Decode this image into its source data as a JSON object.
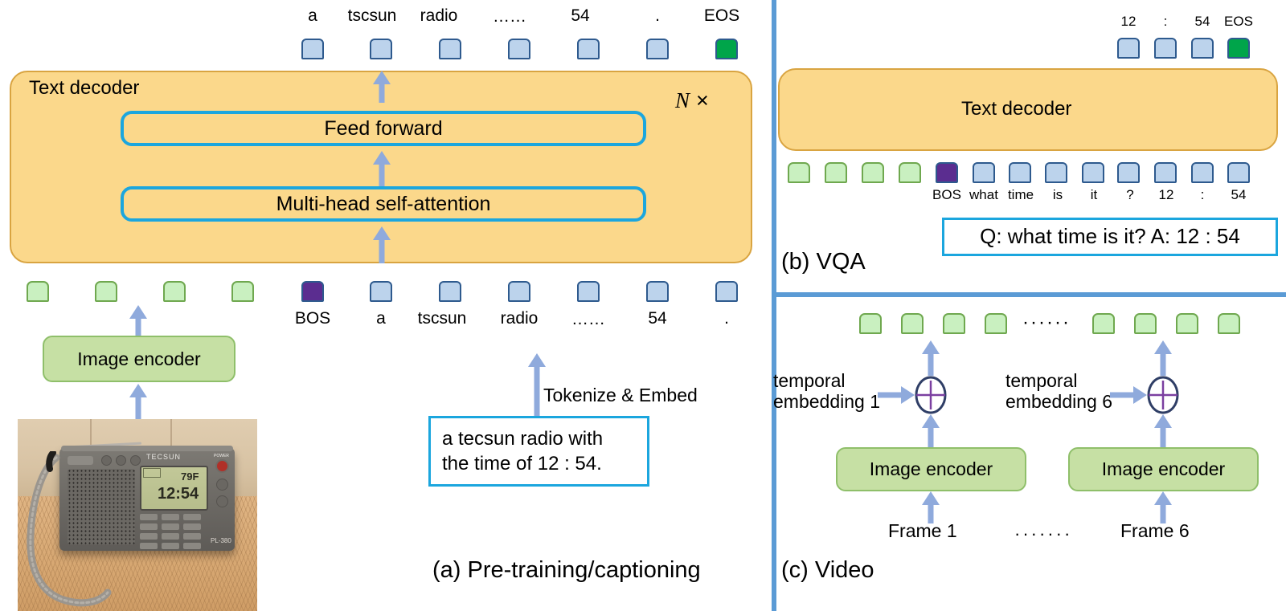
{
  "figure": {
    "panels": [
      {
        "id": "a",
        "caption": "(a) Pre-training/captioning"
      },
      {
        "id": "b",
        "caption": "(b) VQA"
      },
      {
        "id": "c",
        "caption": "(c) Video"
      }
    ]
  },
  "panel_a": {
    "output_tokens": [
      {
        "label": "a",
        "kind": "text"
      },
      {
        "label": "tscsun",
        "kind": "text"
      },
      {
        "label": "radio",
        "kind": "text"
      },
      {
        "label": "……",
        "kind": "text"
      },
      {
        "label": "54",
        "kind": "text"
      },
      {
        "label": ".",
        "kind": "text"
      },
      {
        "label": "EOS",
        "kind": "eos"
      }
    ],
    "decoder": {
      "title": "Text decoder",
      "repeat_label": "N ×",
      "repeat_symbol_n": "N",
      "repeat_symbol_x": "×",
      "sublayers": [
        {
          "label": "Feed forward"
        },
        {
          "label": "Multi-head self-attention"
        }
      ]
    },
    "image_tokens_count": 4,
    "input_tokens": [
      {
        "label": "BOS",
        "kind": "bos"
      },
      {
        "label": "a",
        "kind": "text"
      },
      {
        "label": "tscsun",
        "kind": "text"
      },
      {
        "label": "radio",
        "kind": "text"
      },
      {
        "label": "……",
        "kind": "text"
      },
      {
        "label": "54",
        "kind": "text"
      },
      {
        "label": ".",
        "kind": "text"
      }
    ],
    "image_encoder_label": "Image encoder",
    "tokenize_label": "Tokenize & Embed",
    "caption_box_line1": "a tecsun radio with",
    "caption_box_line2": "the time of 12 : 54.",
    "photo": {
      "alt": "photo of a Tecsun PL-380 portable radio on a woven mat",
      "brand_text": "TECSUN",
      "model_text": "PL-380",
      "lcd_temperature": "79F",
      "lcd_time": "12:54",
      "power_label": "POWER"
    }
  },
  "panel_b": {
    "output_tokens": [
      {
        "label": "12",
        "kind": "text"
      },
      {
        "label": ":",
        "kind": "text"
      },
      {
        "label": "54",
        "kind": "text"
      },
      {
        "label": "EOS",
        "kind": "eos"
      }
    ],
    "decoder_title": "Text decoder",
    "image_tokens_count": 4,
    "input_tokens": [
      {
        "label": "BOS",
        "kind": "bos"
      },
      {
        "label": "what",
        "kind": "text"
      },
      {
        "label": "time",
        "kind": "text"
      },
      {
        "label": "is",
        "kind": "text"
      },
      {
        "label": "it",
        "kind": "text"
      },
      {
        "label": "?",
        "kind": "text"
      },
      {
        "label": "12",
        "kind": "text"
      },
      {
        "label": ":",
        "kind": "text"
      },
      {
        "label": "54",
        "kind": "text"
      }
    ],
    "qa_box": "Q: what time is it? A: 12 : 54"
  },
  "panel_c": {
    "token_groups_count": 8,
    "ellipsis": "······",
    "frames_ellipsis": "·······",
    "units": [
      {
        "temporal_label_line1": "temporal",
        "temporal_label_line2": "embedding 1",
        "encoder_label": "Image encoder",
        "frame_label": "Frame 1"
      },
      {
        "temporal_label_line1": "temporal",
        "temporal_label_line2": "embedding 6",
        "encoder_label": "Image encoder",
        "frame_label": "Frame 6"
      }
    ]
  },
  "colors": {
    "decoder_fill": "#FBD88B",
    "decoder_border": "#D9A441",
    "sublayer_border": "#1BA6DE",
    "encoder_fill": "#C6E0A4",
    "encoder_border": "#8FBF6A",
    "text_token_fill": "#BCD3EC",
    "text_token_border": "#2E5A8E",
    "image_token_fill": "#C9F0C0",
    "image_token_border": "#6FA84F",
    "bos_fill": "#5B2D90",
    "eos_fill": "#00A54A",
    "arrow": "#8FAADC",
    "divider": "#5B9BD5"
  }
}
